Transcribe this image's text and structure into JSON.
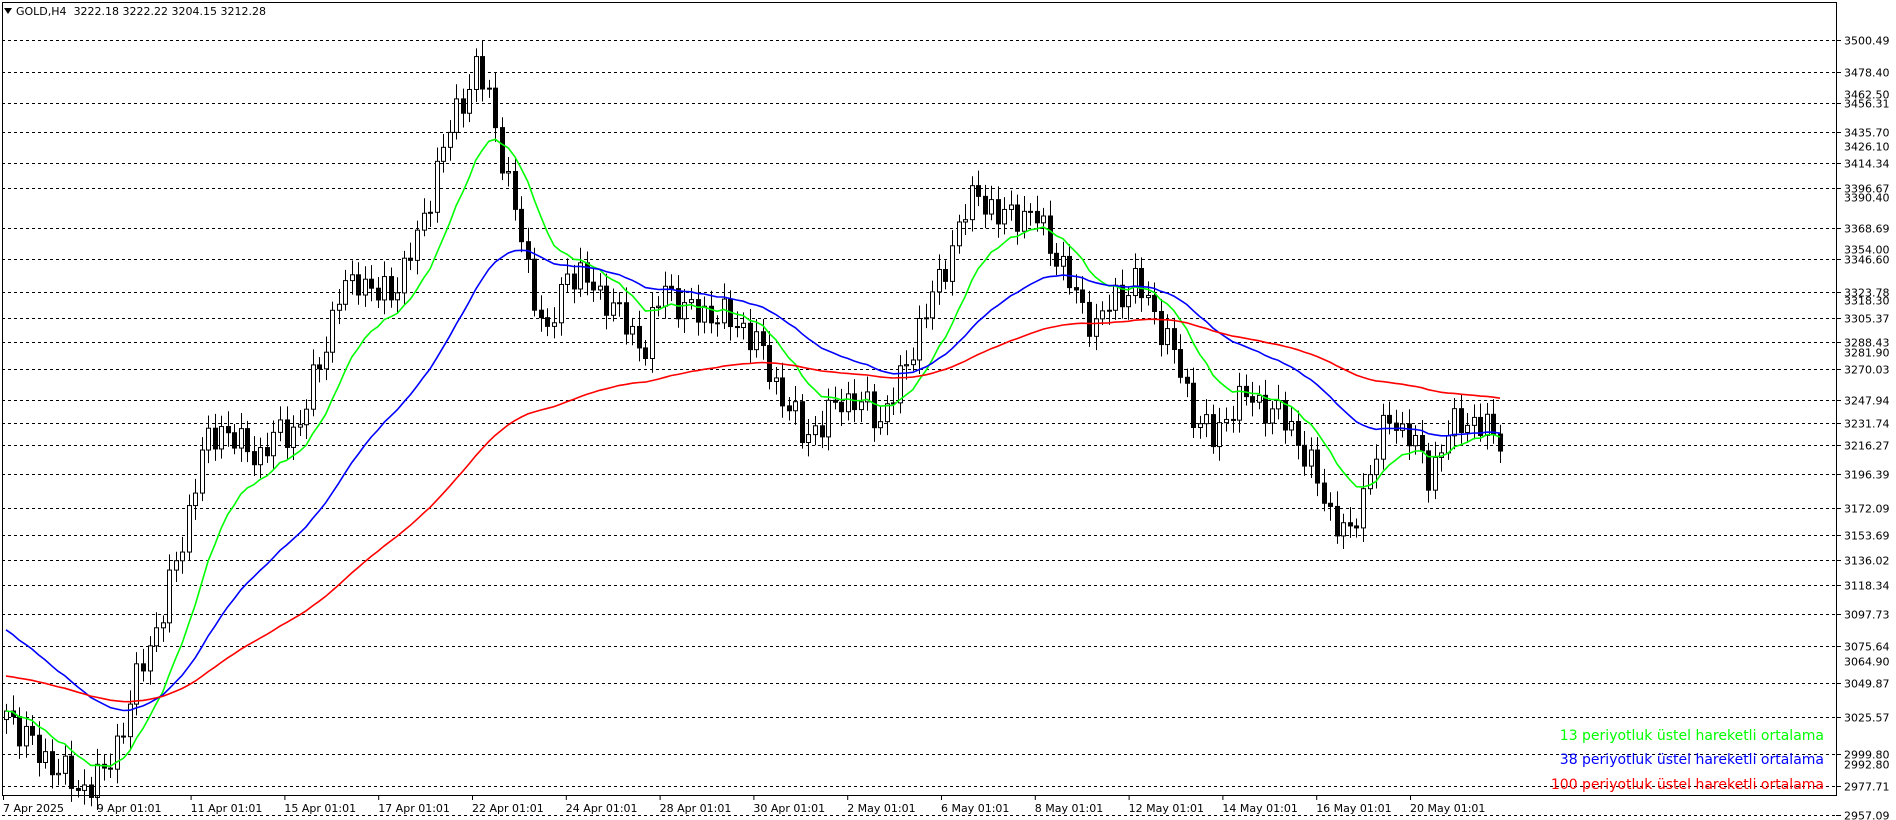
{
  "header": {
    "symbol": "GOLD,H4",
    "ohlc": "3222.18 3222.22 3204.15 3212.28"
  },
  "legend": [
    {
      "label": "13 periyotluk üstel hareketli ortalama",
      "color": "#00ff00"
    },
    {
      "label": "38 periyotluk üstel hareketli ortalama",
      "color": "#0000ff"
    },
    {
      "label": "100 periyotluk üstel hareketli ortalama",
      "color": "#ff0000"
    }
  ],
  "chart_data": {
    "type": "candlestick",
    "symbol": "GOLD",
    "timeframe": "H4",
    "ylim": [
      2945,
      3512
    ],
    "grid": true,
    "price_labels": [
      "3500.49",
      "3478.40",
      "3456.31",
      "3435.70",
      "3414.34",
      "3396.67",
      "3368.69",
      "3346.60",
      "3323.78",
      "3305.37",
      "3288.43",
      "3270.03",
      "3247.94",
      "3231.74",
      "3216.27",
      "3196.39",
      "3172.09",
      "3153.69",
      "3136.02",
      "3118.34",
      "3097.73",
      "3075.64",
      "3049.87",
      "3025.57",
      "2999.80",
      "2977.71",
      "2957.09"
    ],
    "secondary_price_labels": [
      "3462.50",
      "3426.10",
      "3390.40",
      "3354.00",
      "3318.30",
      "3281.90",
      "3064.90",
      "2992.80"
    ],
    "x_labels": [
      "7 Apr 2025",
      "9 Apr 01:01",
      "11 Apr 01:01",
      "15 Apr 01:01",
      "17 Apr 01:01",
      "22 Apr 01:01",
      "24 Apr 01:01",
      "28 Apr 01:01",
      "30 Apr 01:01",
      "2 May 01:01",
      "6 May 01:01",
      "8 May 01:01",
      "12 May 01:01",
      "14 May 01:01",
      "16 May 01:01",
      "20 May 01:01"
    ],
    "anchors": [
      [
        0,
        3030
      ],
      [
        5,
        3000
      ],
      [
        8,
        2990
      ],
      [
        11,
        2975
      ],
      [
        15,
        2985
      ],
      [
        18,
        3020
      ],
      [
        21,
        3065
      ],
      [
        24,
        3100
      ],
      [
        27,
        3150
      ],
      [
        30,
        3210
      ],
      [
        33,
        3230
      ],
      [
        36,
        3215
      ],
      [
        39,
        3210
      ],
      [
        42,
        3225
      ],
      [
        45,
        3230
      ],
      [
        48,
        3275
      ],
      [
        51,
        3320
      ],
      [
        54,
        3335
      ],
      [
        57,
        3320
      ],
      [
        60,
        3330
      ],
      [
        63,
        3360
      ],
      [
        66,
        3410
      ],
      [
        69,
        3450
      ],
      [
        72,
        3480
      ],
      [
        74,
        3460
      ],
      [
        77,
        3400
      ],
      [
        80,
        3340
      ],
      [
        83,
        3290
      ],
      [
        86,
        3340
      ],
      [
        89,
        3330
      ],
      [
        92,
        3320
      ],
      [
        95,
        3300
      ],
      [
        98,
        3285
      ],
      [
        101,
        3330
      ],
      [
        104,
        3310
      ],
      [
        107,
        3310
      ],
      [
        110,
        3305
      ],
      [
        113,
        3300
      ],
      [
        116,
        3280
      ],
      [
        119,
        3250
      ],
      [
        122,
        3225
      ],
      [
        125,
        3230
      ],
      [
        128,
        3250
      ],
      [
        131,
        3245
      ],
      [
        134,
        3235
      ],
      [
        137,
        3260
      ],
      [
        140,
        3300
      ],
      [
        143,
        3330
      ],
      [
        146,
        3370
      ],
      [
        149,
        3395
      ],
      [
        152,
        3375
      ],
      [
        155,
        3380
      ],
      [
        158,
        3375
      ],
      [
        161,
        3350
      ],
      [
        164,
        3320
      ],
      [
        167,
        3300
      ],
      [
        170,
        3320
      ],
      [
        173,
        3330
      ],
      [
        176,
        3310
      ],
      [
        179,
        3280
      ],
      [
        182,
        3240
      ],
      [
        185,
        3220
      ],
      [
        188,
        3245
      ],
      [
        191,
        3250
      ],
      [
        194,
        3240
      ],
      [
        197,
        3230
      ],
      [
        200,
        3200
      ],
      [
        203,
        3170
      ],
      [
        206,
        3150
      ],
      [
        209,
        3200
      ],
      [
        212,
        3235
      ],
      [
        215,
        3225
      ],
      [
        218,
        3195
      ],
      [
        221,
        3225
      ],
      [
        224,
        3235
      ],
      [
        227,
        3228
      ],
      [
        229,
        3212
      ]
    ],
    "series": [
      {
        "name": "13 periyotluk üstel hareketli ortalama",
        "period": 13,
        "color": "#00ff00"
      },
      {
        "name": "38 periyotluk üstel hareketli ortalama",
        "period": 38,
        "color": "#0000ff"
      },
      {
        "name": "100 periyotluk üstel hareketli ortalama",
        "period": 100,
        "color": "#ff0000"
      }
    ]
  }
}
